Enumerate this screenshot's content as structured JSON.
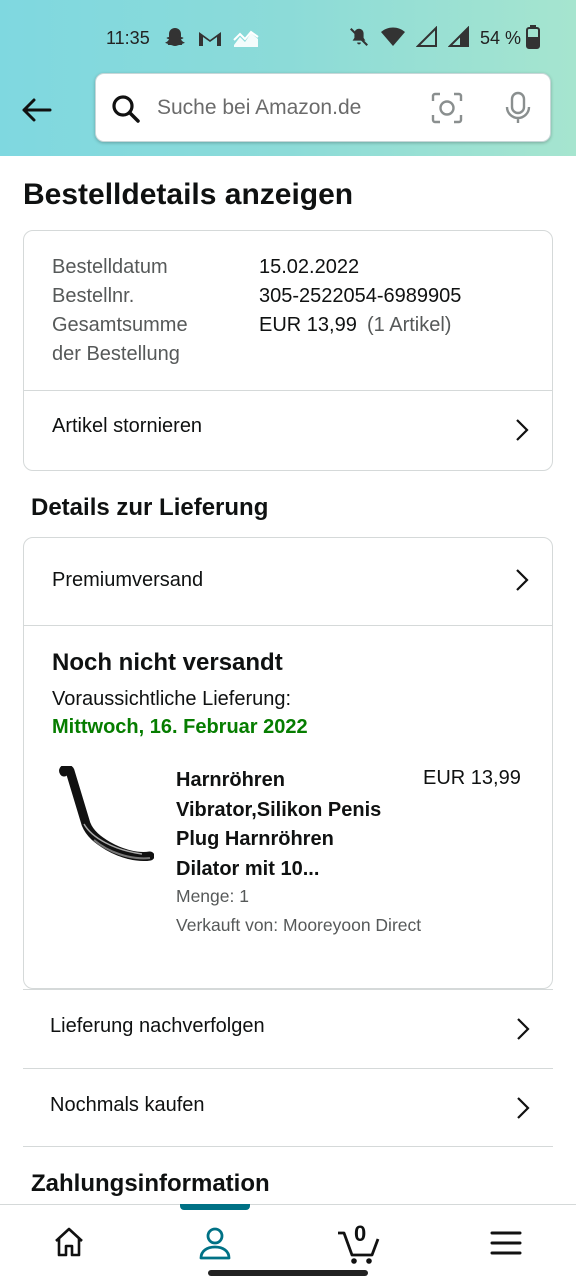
{
  "status_bar": {
    "time": "11:35",
    "battery": "54 %"
  },
  "search": {
    "placeholder": "Suche bei Amazon.de"
  },
  "page_title": "Bestelldetails anzeigen",
  "order": {
    "date_label": "Bestelldatum",
    "date_value": "15.02.2022",
    "number_label": "Bestellnr.",
    "number_value": "305-2522054-6989905",
    "total_label_1": "Gesamtsumme",
    "total_label_2": "der Bestellung",
    "total_value": "EUR 13,99",
    "total_count": "(1 Artikel)",
    "cancel_label": "Artikel stornieren"
  },
  "delivery": {
    "section_title": "Details zur Lieferung",
    "shipping_method": "Premiumversand",
    "status": "Noch nicht versandt",
    "expected_label": "Voraussichtliche Lieferung:",
    "expected_date": "Mittwoch, 16. Februar 2022",
    "product": {
      "title_lines": [
        "Harnröhren",
        "Vibrator,Silikon Penis",
        "Plug Harnröhren",
        "Dilator mit 10..."
      ],
      "price": "EUR 13,99",
      "quantity": "Menge: 1",
      "seller": "Verkauft von: Mooreyoon Direct"
    }
  },
  "actions": {
    "track": "Lieferung nachverfolgen",
    "buy_again": "Nochmals kaufen"
  },
  "payment": {
    "section_title": "Zahlungsinformation"
  },
  "bottom_nav": {
    "cart_count": "0",
    "items": [
      "home-icon",
      "account-icon",
      "cart-icon",
      "menu-icon"
    ]
  },
  "colors": {
    "accent": "#007185",
    "delivery_green": "#067d00"
  }
}
